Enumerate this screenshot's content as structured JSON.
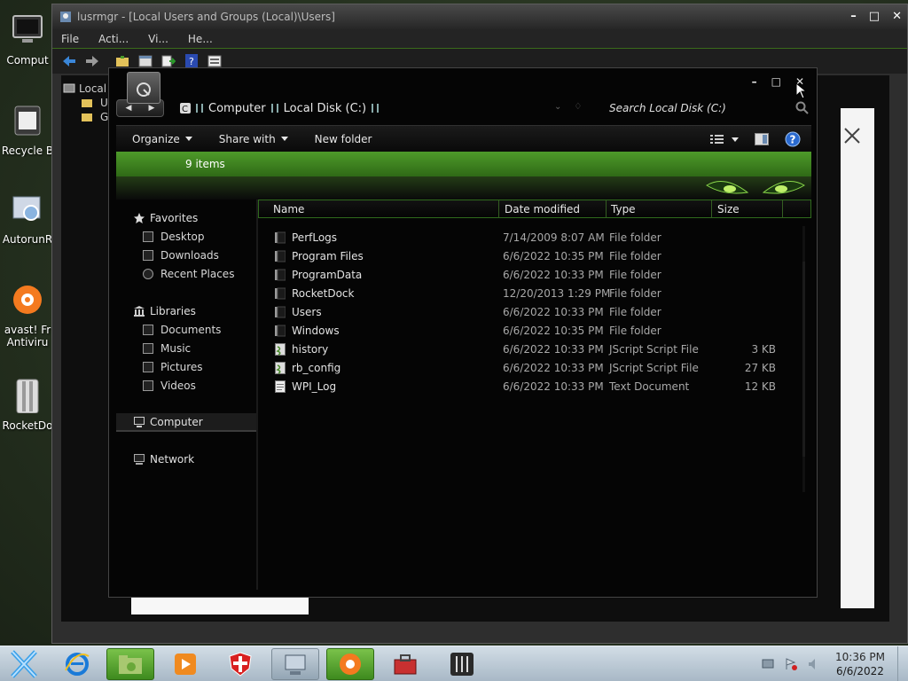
{
  "desktop": {
    "icons": [
      {
        "label": "Comput",
        "icon": "computer-icon"
      },
      {
        "label": "Recycle B",
        "icon": "recycle-bin-icon"
      },
      {
        "label": "AutorunR",
        "icon": "autoruns-icon"
      },
      {
        "label": "avast! Fr",
        "label2": "Antiviru",
        "icon": "avast-icon"
      },
      {
        "label": "RocketDo",
        "icon": "rocketdock-icon"
      }
    ]
  },
  "lusrmgr": {
    "title": "lusrmgr - [Local Users and Groups (Local)\\Users]",
    "menu": [
      "File",
      "Acti...",
      "Vi...",
      "He..."
    ],
    "tree": {
      "root": "Local",
      "items": [
        "U",
        "G"
      ]
    }
  },
  "explorer": {
    "breadcrumb": [
      "Computer",
      "Local Disk (C:)"
    ],
    "search_placeholder": "Search Local Disk (C:)",
    "commands": {
      "organize": "Organize",
      "share_with": "Share with",
      "new_folder": "New folder"
    },
    "item_count": "9 items",
    "nav": {
      "favorites": {
        "label": "Favorites",
        "items": [
          "Desktop",
          "Downloads",
          "Recent Places"
        ]
      },
      "libraries": {
        "label": "Libraries",
        "items": [
          "Documents",
          "Music",
          "Pictures",
          "Videos"
        ]
      },
      "computer": "Computer",
      "network": "Network"
    },
    "columns": {
      "name": "Name",
      "date": "Date modified",
      "type": "Type",
      "size": "Size"
    },
    "files": [
      {
        "name": "PerfLogs",
        "date": "7/14/2009 8:07 AM",
        "type": "File folder",
        "size": "",
        "icon": "folder-icon"
      },
      {
        "name": "Program Files",
        "date": "6/6/2022 10:35 PM",
        "type": "File folder",
        "size": "",
        "icon": "folder-icon"
      },
      {
        "name": "ProgramData",
        "date": "6/6/2022 10:33 PM",
        "type": "File folder",
        "size": "",
        "icon": "folder-icon"
      },
      {
        "name": "RocketDock",
        "date": "12/20/2013 1:29 PM",
        "type": "File folder",
        "size": "",
        "icon": "folder-icon"
      },
      {
        "name": "Users",
        "date": "6/6/2022 10:33 PM",
        "type": "File folder",
        "size": "",
        "icon": "folder-icon"
      },
      {
        "name": "Windows",
        "date": "6/6/2022 10:35 PM",
        "type": "File folder",
        "size": "",
        "icon": "folder-icon"
      },
      {
        "name": "history",
        "date": "6/6/2022 10:33 PM",
        "type": "JScript Script File",
        "size": "3 KB",
        "icon": "script-icon"
      },
      {
        "name": "rb_config",
        "date": "6/6/2022 10:33 PM",
        "type": "JScript Script File",
        "size": "27 KB",
        "icon": "script-icon"
      },
      {
        "name": "WPI_Log",
        "date": "6/6/2022 10:33 PM",
        "type": "Text Document",
        "size": "12 KB",
        "icon": "text-document-icon"
      }
    ]
  },
  "taskbar": {
    "time": "10:36 PM",
    "date": "6/6/2022"
  },
  "colors": {
    "accent_green": "#4e9a2a",
    "taskbar": "#b8c8d4",
    "window_bg": "#050505"
  }
}
